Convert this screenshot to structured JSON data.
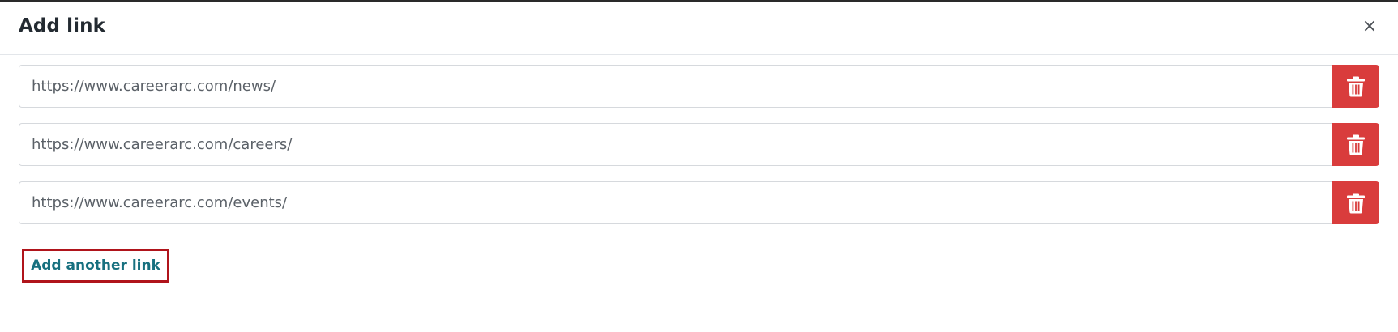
{
  "modal": {
    "title": "Add link",
    "close_icon": "close-icon",
    "close_glyph": "×"
  },
  "links": [
    {
      "value": "https://www.careerarc.com/news/",
      "delete_icon": "trash-icon"
    },
    {
      "value": "https://www.careerarc.com/careers/",
      "delete_icon": "trash-icon"
    },
    {
      "value": "https://www.careerarc.com/events/",
      "delete_icon": "trash-icon"
    }
  ],
  "add_link": {
    "label": "Add another link"
  },
  "colors": {
    "delete_button": "#d93c3c",
    "add_link_text": "#17707f",
    "add_link_focus_border": "#b0141b",
    "title_text": "#232a31"
  }
}
